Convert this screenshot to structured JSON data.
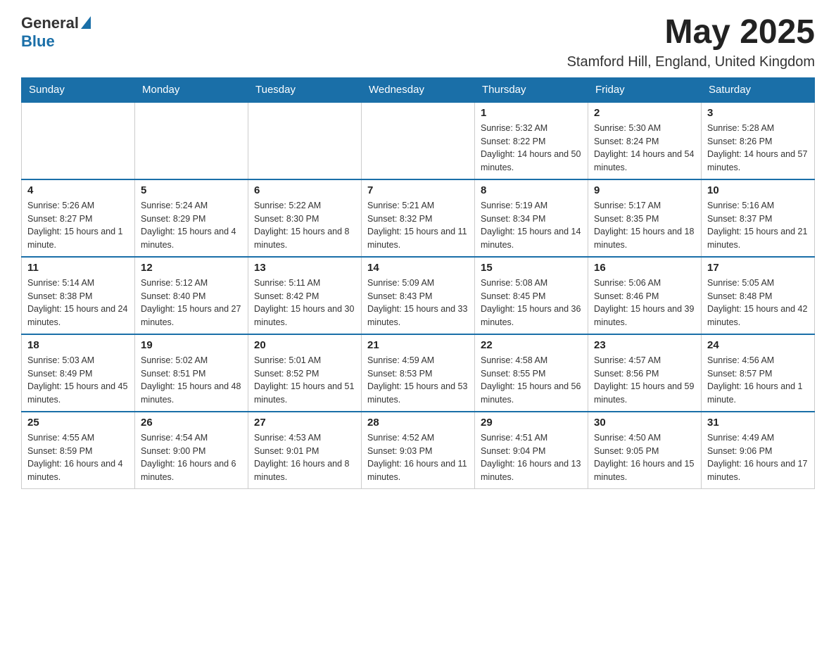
{
  "header": {
    "logo_general": "General",
    "logo_blue": "Blue",
    "month_year": "May 2025",
    "location": "Stamford Hill, England, United Kingdom"
  },
  "days_of_week": [
    "Sunday",
    "Monday",
    "Tuesday",
    "Wednesday",
    "Thursday",
    "Friday",
    "Saturday"
  ],
  "weeks": [
    {
      "cells": [
        {
          "day": "",
          "info": ""
        },
        {
          "day": "",
          "info": ""
        },
        {
          "day": "",
          "info": ""
        },
        {
          "day": "",
          "info": ""
        },
        {
          "day": "1",
          "info": "Sunrise: 5:32 AM\nSunset: 8:22 PM\nDaylight: 14 hours and 50 minutes."
        },
        {
          "day": "2",
          "info": "Sunrise: 5:30 AM\nSunset: 8:24 PM\nDaylight: 14 hours and 54 minutes."
        },
        {
          "day": "3",
          "info": "Sunrise: 5:28 AM\nSunset: 8:26 PM\nDaylight: 14 hours and 57 minutes."
        }
      ]
    },
    {
      "cells": [
        {
          "day": "4",
          "info": "Sunrise: 5:26 AM\nSunset: 8:27 PM\nDaylight: 15 hours and 1 minute."
        },
        {
          "day": "5",
          "info": "Sunrise: 5:24 AM\nSunset: 8:29 PM\nDaylight: 15 hours and 4 minutes."
        },
        {
          "day": "6",
          "info": "Sunrise: 5:22 AM\nSunset: 8:30 PM\nDaylight: 15 hours and 8 minutes."
        },
        {
          "day": "7",
          "info": "Sunrise: 5:21 AM\nSunset: 8:32 PM\nDaylight: 15 hours and 11 minutes."
        },
        {
          "day": "8",
          "info": "Sunrise: 5:19 AM\nSunset: 8:34 PM\nDaylight: 15 hours and 14 minutes."
        },
        {
          "day": "9",
          "info": "Sunrise: 5:17 AM\nSunset: 8:35 PM\nDaylight: 15 hours and 18 minutes."
        },
        {
          "day": "10",
          "info": "Sunrise: 5:16 AM\nSunset: 8:37 PM\nDaylight: 15 hours and 21 minutes."
        }
      ]
    },
    {
      "cells": [
        {
          "day": "11",
          "info": "Sunrise: 5:14 AM\nSunset: 8:38 PM\nDaylight: 15 hours and 24 minutes."
        },
        {
          "day": "12",
          "info": "Sunrise: 5:12 AM\nSunset: 8:40 PM\nDaylight: 15 hours and 27 minutes."
        },
        {
          "day": "13",
          "info": "Sunrise: 5:11 AM\nSunset: 8:42 PM\nDaylight: 15 hours and 30 minutes."
        },
        {
          "day": "14",
          "info": "Sunrise: 5:09 AM\nSunset: 8:43 PM\nDaylight: 15 hours and 33 minutes."
        },
        {
          "day": "15",
          "info": "Sunrise: 5:08 AM\nSunset: 8:45 PM\nDaylight: 15 hours and 36 minutes."
        },
        {
          "day": "16",
          "info": "Sunrise: 5:06 AM\nSunset: 8:46 PM\nDaylight: 15 hours and 39 minutes."
        },
        {
          "day": "17",
          "info": "Sunrise: 5:05 AM\nSunset: 8:48 PM\nDaylight: 15 hours and 42 minutes."
        }
      ]
    },
    {
      "cells": [
        {
          "day": "18",
          "info": "Sunrise: 5:03 AM\nSunset: 8:49 PM\nDaylight: 15 hours and 45 minutes."
        },
        {
          "day": "19",
          "info": "Sunrise: 5:02 AM\nSunset: 8:51 PM\nDaylight: 15 hours and 48 minutes."
        },
        {
          "day": "20",
          "info": "Sunrise: 5:01 AM\nSunset: 8:52 PM\nDaylight: 15 hours and 51 minutes."
        },
        {
          "day": "21",
          "info": "Sunrise: 4:59 AM\nSunset: 8:53 PM\nDaylight: 15 hours and 53 minutes."
        },
        {
          "day": "22",
          "info": "Sunrise: 4:58 AM\nSunset: 8:55 PM\nDaylight: 15 hours and 56 minutes."
        },
        {
          "day": "23",
          "info": "Sunrise: 4:57 AM\nSunset: 8:56 PM\nDaylight: 15 hours and 59 minutes."
        },
        {
          "day": "24",
          "info": "Sunrise: 4:56 AM\nSunset: 8:57 PM\nDaylight: 16 hours and 1 minute."
        }
      ]
    },
    {
      "cells": [
        {
          "day": "25",
          "info": "Sunrise: 4:55 AM\nSunset: 8:59 PM\nDaylight: 16 hours and 4 minutes."
        },
        {
          "day": "26",
          "info": "Sunrise: 4:54 AM\nSunset: 9:00 PM\nDaylight: 16 hours and 6 minutes."
        },
        {
          "day": "27",
          "info": "Sunrise: 4:53 AM\nSunset: 9:01 PM\nDaylight: 16 hours and 8 minutes."
        },
        {
          "day": "28",
          "info": "Sunrise: 4:52 AM\nSunset: 9:03 PM\nDaylight: 16 hours and 11 minutes."
        },
        {
          "day": "29",
          "info": "Sunrise: 4:51 AM\nSunset: 9:04 PM\nDaylight: 16 hours and 13 minutes."
        },
        {
          "day": "30",
          "info": "Sunrise: 4:50 AM\nSunset: 9:05 PM\nDaylight: 16 hours and 15 minutes."
        },
        {
          "day": "31",
          "info": "Sunrise: 4:49 AM\nSunset: 9:06 PM\nDaylight: 16 hours and 17 minutes."
        }
      ]
    }
  ]
}
